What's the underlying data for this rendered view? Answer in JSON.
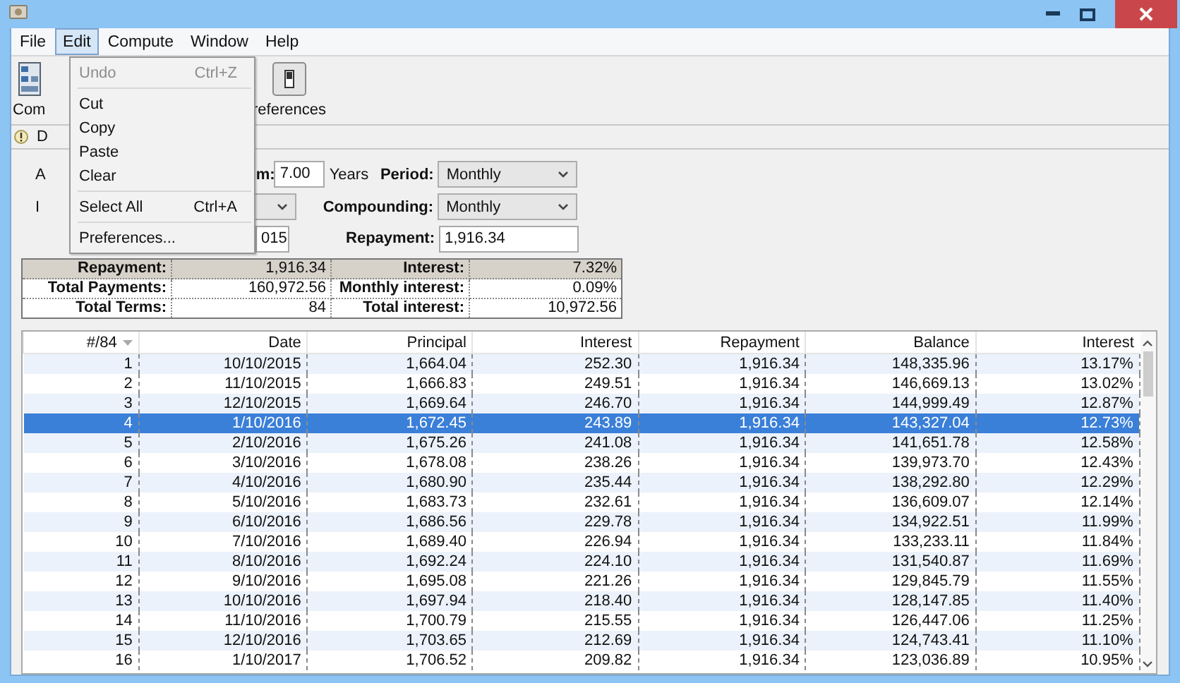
{
  "menu_bar": [
    {
      "label": "File",
      "selected": false
    },
    {
      "label": "Edit",
      "selected": true
    },
    {
      "label": "Compute",
      "selected": false
    },
    {
      "label": "Window",
      "selected": false
    },
    {
      "label": "Help",
      "selected": false
    }
  ],
  "open_menu": [
    {
      "kind": "item",
      "label": "Undo",
      "shortcut": "Ctrl+Z",
      "disabled": true
    },
    {
      "kind": "separator"
    },
    {
      "kind": "item",
      "label": "Cut",
      "disabled": false
    },
    {
      "kind": "item",
      "label": "Copy",
      "disabled": false
    },
    {
      "kind": "item",
      "label": "Paste",
      "disabled": false
    },
    {
      "kind": "item",
      "label": "Clear",
      "disabled": false
    },
    {
      "kind": "separator"
    },
    {
      "kind": "item",
      "label": "Select All",
      "shortcut": "Ctrl+A",
      "disabled": false
    },
    {
      "kind": "separator"
    },
    {
      "kind": "item",
      "label": "Preferences...",
      "disabled": false
    }
  ],
  "toolbar": [
    {
      "kind": "compute",
      "label": "Com"
    },
    {
      "kind": "preferences",
      "label": "references"
    }
  ],
  "tab": {
    "label": "D"
  },
  "form": {
    "label_1": "A",
    "label_2": "I",
    "term_label": "m:",
    "term": "7.00",
    "term_unit": "Years",
    "period_label": "Period:",
    "period": "Monthly",
    "start_date": "015",
    "compounding_label": "Compounding:",
    "compounding": "Monthly",
    "repayment_label": "Repayment:",
    "repayment": "1,916.34"
  },
  "summary": [
    {
      "highlighted": true,
      "cells": [
        "Repayment:",
        "1,916.34",
        "Interest:",
        "7.32%"
      ]
    },
    {
      "highlighted": false,
      "cells": [
        "Total Payments:",
        "160,972.56",
        "Monthly interest:",
        "0.09%"
      ]
    },
    {
      "highlighted": false,
      "cells": [
        "Total Terms:",
        "84",
        "Total interest:",
        "10,972.56"
      ]
    }
  ],
  "table": {
    "columns": [
      {
        "label": "#/84",
        "sorted": true
      },
      {
        "label": "Date",
        "sorted": false
      },
      {
        "label": "Principal",
        "sorted": false
      },
      {
        "label": "Interest",
        "sorted": false
      },
      {
        "label": "Repayment",
        "sorted": false
      },
      {
        "label": "Balance",
        "sorted": false
      },
      {
        "label": "Interest",
        "sorted": false
      }
    ],
    "rows": [
      {
        "selected": false,
        "cells": [
          "1",
          "10/10/2015",
          "1,664.04",
          "252.30",
          "1,916.34",
          "148,335.96",
          "13.17%"
        ]
      },
      {
        "selected": false,
        "cells": [
          "2",
          "11/10/2015",
          "1,666.83",
          "249.51",
          "1,916.34",
          "146,669.13",
          "13.02%"
        ]
      },
      {
        "selected": false,
        "cells": [
          "3",
          "12/10/2015",
          "1,669.64",
          "246.70",
          "1,916.34",
          "144,999.49",
          "12.87%"
        ]
      },
      {
        "selected": true,
        "cells": [
          "4",
          "1/10/2016",
          "1,672.45",
          "243.89",
          "1,916.34",
          "143,327.04",
          "12.73%"
        ]
      },
      {
        "selected": false,
        "cells": [
          "5",
          "2/10/2016",
          "1,675.26",
          "241.08",
          "1,916.34",
          "141,651.78",
          "12.58%"
        ]
      },
      {
        "selected": false,
        "cells": [
          "6",
          "3/10/2016",
          "1,678.08",
          "238.26",
          "1,916.34",
          "139,973.70",
          "12.43%"
        ]
      },
      {
        "selected": false,
        "cells": [
          "7",
          "4/10/2016",
          "1,680.90",
          "235.44",
          "1,916.34",
          "138,292.80",
          "12.29%"
        ]
      },
      {
        "selected": false,
        "cells": [
          "8",
          "5/10/2016",
          "1,683.73",
          "232.61",
          "1,916.34",
          "136,609.07",
          "12.14%"
        ]
      },
      {
        "selected": false,
        "cells": [
          "9",
          "6/10/2016",
          "1,686.56",
          "229.78",
          "1,916.34",
          "134,922.51",
          "11.99%"
        ]
      },
      {
        "selected": false,
        "cells": [
          "10",
          "7/10/2016",
          "1,689.40",
          "226.94",
          "1,916.34",
          "133,233.11",
          "11.84%"
        ]
      },
      {
        "selected": false,
        "cells": [
          "11",
          "8/10/2016",
          "1,692.24",
          "224.10",
          "1,916.34",
          "131,540.87",
          "11.69%"
        ]
      },
      {
        "selected": false,
        "cells": [
          "12",
          "9/10/2016",
          "1,695.08",
          "221.26",
          "1,916.34",
          "129,845.79",
          "11.55%"
        ]
      },
      {
        "selected": false,
        "cells": [
          "13",
          "10/10/2016",
          "1,697.94",
          "218.40",
          "1,916.34",
          "128,147.85",
          "11.40%"
        ]
      },
      {
        "selected": false,
        "cells": [
          "14",
          "11/10/2016",
          "1,700.79",
          "215.55",
          "1,916.34",
          "126,447.06",
          "11.25%"
        ]
      },
      {
        "selected": false,
        "cells": [
          "15",
          "12/10/2016",
          "1,703.65",
          "212.69",
          "1,916.34",
          "124,743.41",
          "11.10%"
        ]
      },
      {
        "selected": false,
        "cells": [
          "16",
          "1/10/2017",
          "1,706.52",
          "209.82",
          "1,916.34",
          "123,036.89",
          "10.95%"
        ]
      }
    ]
  }
}
